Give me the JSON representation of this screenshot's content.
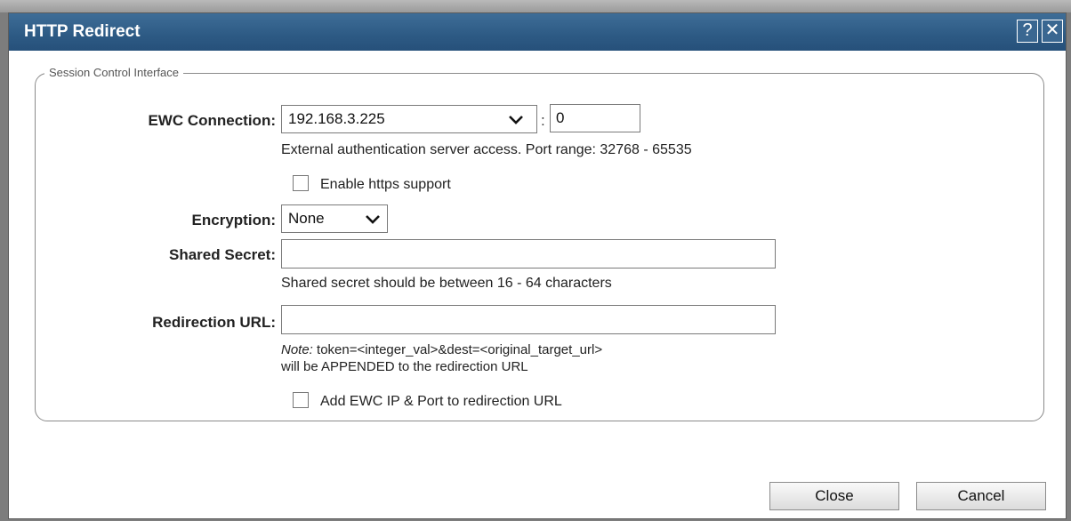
{
  "dialog": {
    "title": "HTTP Redirect",
    "help_label": "?",
    "close_label": "✕"
  },
  "fieldset": {
    "legend": "Session Control Interface"
  },
  "ewc": {
    "label": "EWC Connection:",
    "ip_value": "192.168.3.225",
    "separator": ":",
    "port_value": "0",
    "help_text": "External authentication server access. Port range: 32768 - 65535"
  },
  "https": {
    "label": "Enable https support",
    "checked": false
  },
  "encryption": {
    "label": "Encryption:",
    "value": "None"
  },
  "shared_secret": {
    "label": "Shared Secret:",
    "value": "",
    "help_text": "Shared secret should be between 16 - 64 characters"
  },
  "redirection": {
    "label": "Redirection URL:",
    "value": "",
    "note_prefix": "Note:",
    "note_line1": " token=<integer_val>&dest=<original_target_url>",
    "note_line2": "will be APPENDED to the redirection URL"
  },
  "add_ewc": {
    "label": "Add EWC IP & Port to redirection URL",
    "checked": false
  },
  "buttons": {
    "close": "Close",
    "cancel": "Cancel"
  },
  "colors": {
    "titlebar": "#2d5a84",
    "backdrop": "#7d7d7d"
  }
}
